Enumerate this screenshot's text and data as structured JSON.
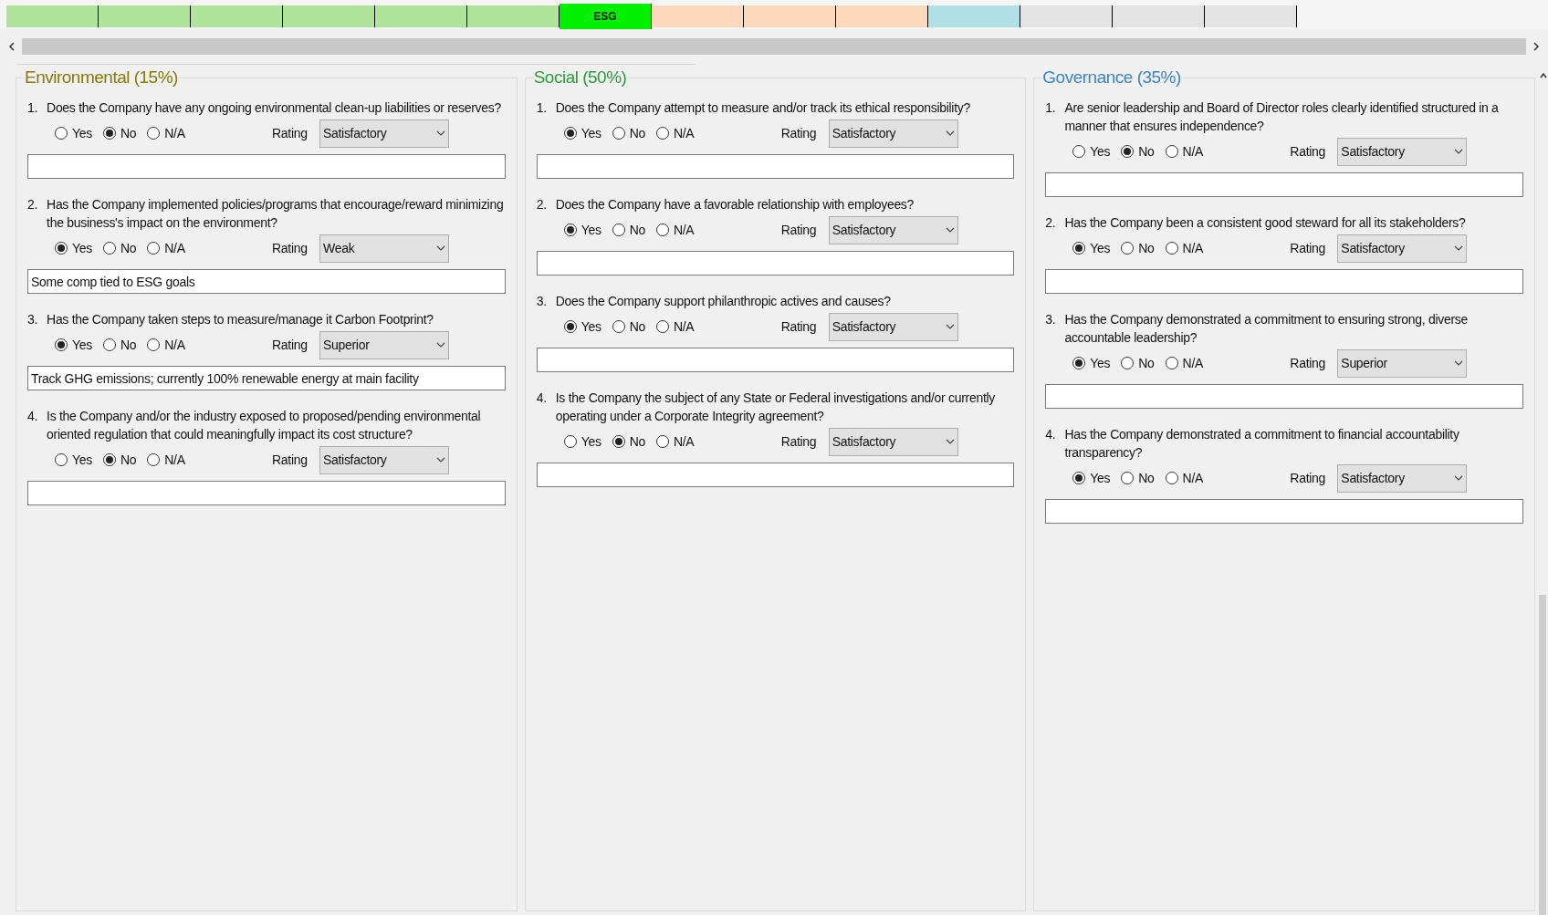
{
  "tabs": [
    {
      "color": "#b0e49a",
      "selected": false
    },
    {
      "color": "#b0e49a",
      "selected": false
    },
    {
      "color": "#b0e49a",
      "selected": false
    },
    {
      "color": "#b0e49a",
      "selected": false
    },
    {
      "color": "#b0e49a",
      "selected": false
    },
    {
      "color": "#b0e49a",
      "selected": false
    },
    {
      "label": "ESG",
      "color": "#00f000",
      "selected": true
    },
    {
      "color": "#fdd9bc",
      "selected": false
    },
    {
      "color": "#fdd9bc",
      "selected": false
    },
    {
      "color": "#fdd9bc",
      "selected": false
    },
    {
      "color": "#b0e0e6",
      "selected": false
    },
    {
      "color": "#e3e3e3",
      "selected": false
    },
    {
      "color": "#e3e3e3",
      "selected": false
    },
    {
      "color": "#e3e3e3",
      "selected": false
    }
  ],
  "sections": [
    {
      "title": "Environmental (15%)",
      "color": "#857a0a",
      "questions": [
        {
          "number": "1.",
          "text": "Does the Company have any ongoing environmental clean-up liabilities or reserves?",
          "options": [
            {
              "label": "Yes",
              "selected": false
            },
            {
              "label": "No",
              "selected": true
            },
            {
              "label": "N/A",
              "selected": false
            }
          ],
          "rating_label": "Rating",
          "rating": "Satisfactory"
        },
        {
          "number": "2.",
          "text": "Has the Company implemented policies/programs that encourage/reward minimizing the business's impact on the environment?",
          "options": [
            {
              "label": "Yes",
              "selected": true
            },
            {
              "label": "No",
              "selected": false
            },
            {
              "label": "N/A",
              "selected": false
            }
          ],
          "rating_label": "Rating",
          "rating": "Weak",
          "comment": "Some comp tied to ESG goals"
        },
        {
          "number": "3.",
          "text": "Has the Company taken steps to measure/manage it Carbon Footprint?",
          "options": [
            {
              "label": "Yes",
              "selected": true
            },
            {
              "label": "No",
              "selected": false
            },
            {
              "label": "N/A",
              "selected": false
            }
          ],
          "rating_label": "Rating",
          "rating": "Superior",
          "comment": "Track GHG emissions; currently 100% renewable energy at main facility"
        },
        {
          "number": "4.",
          "text": "Is the Company and/or the industry exposed to proposed/pending environmental oriented regulation that could meaningfully impact its cost structure?",
          "options": [
            {
              "label": "Yes",
              "selected": false
            },
            {
              "label": "No",
              "selected": true
            },
            {
              "label": "N/A",
              "selected": false
            }
          ],
          "rating_label": "Rating",
          "rating": "Satisfactory"
        }
      ]
    },
    {
      "title": "Social (50%)",
      "color": "#2e9a3a",
      "questions": [
        {
          "number": "1.",
          "text": "Does the Company attempt to measure and/or track its ethical responsibility?",
          "options": [
            {
              "label": "Yes",
              "selected": true
            },
            {
              "label": "No",
              "selected": false
            },
            {
              "label": "N/A",
              "selected": false
            }
          ],
          "rating_label": "Rating",
          "rating": "Satisfactory"
        },
        {
          "number": "2.",
          "text": "Does the Company have a favorable relationship with employees?",
          "options": [
            {
              "label": "Yes",
              "selected": true
            },
            {
              "label": "No",
              "selected": false
            },
            {
              "label": "N/A",
              "selected": false
            }
          ],
          "rating_label": "Rating",
          "rating": "Satisfactory"
        },
        {
          "number": "3.",
          "text": "Does the Company support philanthropic actives and causes?",
          "options": [
            {
              "label": "Yes",
              "selected": true
            },
            {
              "label": "No",
              "selected": false
            },
            {
              "label": "N/A",
              "selected": false
            }
          ],
          "rating_label": "Rating",
          "rating": "Satisfactory"
        },
        {
          "number": "4.",
          "text": "Is the Company the subject of any State or Federal investigations and/or currently operating under a Corporate Integrity agreement?",
          "options": [
            {
              "label": "Yes",
              "selected": false
            },
            {
              "label": "No",
              "selected": true
            },
            {
              "label": "N/A",
              "selected": false
            }
          ],
          "rating_label": "Rating",
          "rating": "Satisfactory"
        }
      ]
    },
    {
      "title": "Governance (35%)",
      "color": "#3c85c6",
      "questions": [
        {
          "number": "1.",
          "text": "Are senior leadership and Board of Director roles clearly identified  structured in a manner that ensures independence?",
          "options": [
            {
              "label": "Yes",
              "selected": false
            },
            {
              "label": "No",
              "selected": true
            },
            {
              "label": "N/A",
              "selected": false
            }
          ],
          "rating_label": "Rating",
          "rating": "Satisfactory"
        },
        {
          "number": "2.",
          "text": "Has the Company been a consistent good steward for all its stakeholders?",
          "options": [
            {
              "label": "Yes",
              "selected": true
            },
            {
              "label": "No",
              "selected": false
            },
            {
              "label": "N/A",
              "selected": false
            }
          ],
          "rating_label": "Rating",
          "rating": "Satisfactory"
        },
        {
          "number": "3.",
          "text": "Has the Company demonstrated a commitment to ensuring strong, diverse accountable leadership?",
          "options": [
            {
              "label": "Yes",
              "selected": true
            },
            {
              "label": "No",
              "selected": false
            },
            {
              "label": "N/A",
              "selected": false
            }
          ],
          "rating_label": "Rating",
          "rating": "Superior"
        },
        {
          "number": "4.",
          "text": "Has the Company demonstrated a commitment to financial accountability transparency?",
          "options": [
            {
              "label": "Yes",
              "selected": true
            },
            {
              "label": "No",
              "selected": false
            },
            {
              "label": "N/A",
              "selected": false
            }
          ],
          "rating_label": "Rating",
          "rating": "Satisfactory"
        }
      ]
    }
  ]
}
